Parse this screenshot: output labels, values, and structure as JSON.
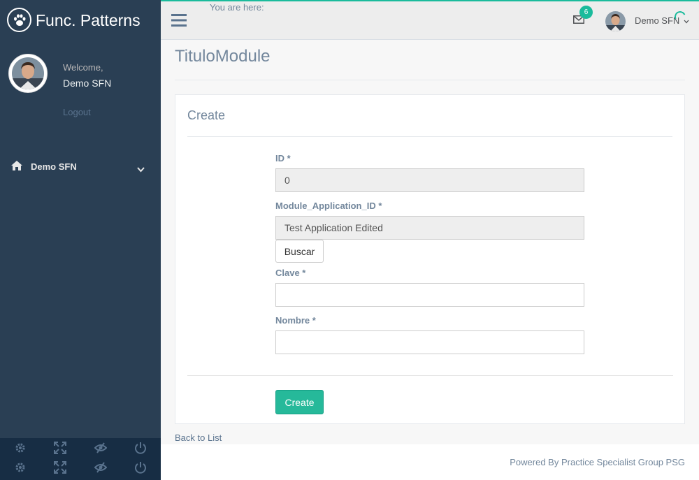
{
  "brand": {
    "name": "Func. Patterns"
  },
  "profile": {
    "welcome": "Welcome,",
    "name": "Demo SFN",
    "logout": "Logout"
  },
  "sidebar": {
    "menu": [
      {
        "label": "Demo SFN",
        "icon": "home-icon"
      }
    ]
  },
  "topnav": {
    "breadcrumb": "You are here:",
    "mail_count": "6",
    "user_name": "Demo SFN"
  },
  "page": {
    "title": "TituloModule"
  },
  "form": {
    "title": "Create",
    "fields": {
      "id": {
        "label": "ID *",
        "value": "0"
      },
      "module_application_id": {
        "label": "Module_Application_ID *",
        "value": "Test Application Edited"
      },
      "clave": {
        "label": "Clave *",
        "value": ""
      },
      "nombre": {
        "label": "Nombre *",
        "value": ""
      }
    },
    "buscar_label": "Buscar",
    "submit_label": "Create"
  },
  "back_link": "Back to List",
  "footer": {
    "text": "Powered By Practice Specialist Group PSG"
  },
  "colors": {
    "accent": "#1abb9c",
    "sidebar": "#2a3f54",
    "button_success": "#26b99a"
  }
}
